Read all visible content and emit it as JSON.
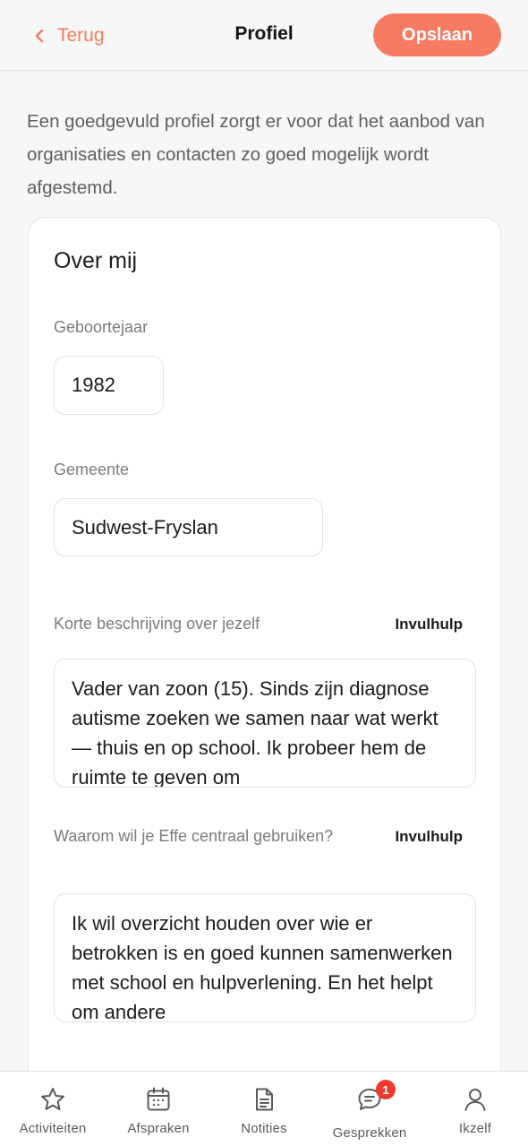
{
  "header": {
    "back_label": "Terug",
    "title": "Profiel",
    "save_label": "Opslaan"
  },
  "intro": "Een goedgevuld profiel zorgt er voor dat het aanbod van organisaties en contacten zo goed mogelijk wordt afgestemd.",
  "card": {
    "title": "Over mij",
    "birth_year": {
      "label": "Geboortejaar",
      "value": "1982"
    },
    "municipality": {
      "label": "Gemeente",
      "value": "Sudwest-Fryslan"
    },
    "description": {
      "label": "Korte beschrijving over jezelf",
      "helper": "Invulhulp",
      "value": "Vader van zoon (15). Sinds zijn diagnose autisme zoeken we samen naar wat werkt — thuis en op school. Ik probeer hem de ruimte te geven om"
    },
    "reason": {
      "label": "Waarom wil je Effe centraal gebruiken?",
      "helper": "Invulhulp",
      "value": "Ik wil overzicht houden over wie er betrokken is en goed kunnen samenwerken met school en hulpverlening. En het helpt om andere"
    }
  },
  "tabs": [
    {
      "label": "Activiteiten",
      "icon": "star-icon"
    },
    {
      "label": "Afspraken",
      "icon": "calendar-icon"
    },
    {
      "label": "Notities",
      "icon": "document-icon"
    },
    {
      "label": "Gesprekken",
      "icon": "chat-icon",
      "badge": "1"
    },
    {
      "label": "Ikzelf",
      "icon": "person-icon"
    }
  ],
  "colors": {
    "accent": "#f77b63",
    "badge": "#ee3a2c"
  }
}
